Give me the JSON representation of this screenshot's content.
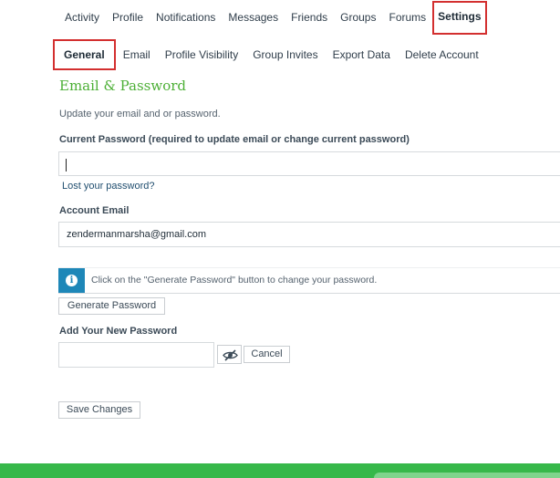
{
  "topnav": {
    "items": [
      {
        "label": "Activity"
      },
      {
        "label": "Profile"
      },
      {
        "label": "Notifications"
      },
      {
        "label": "Messages"
      },
      {
        "label": "Friends"
      },
      {
        "label": "Groups"
      },
      {
        "label": "Forums"
      },
      {
        "label": "Settings",
        "active": true
      }
    ]
  },
  "subnav": {
    "items": [
      {
        "label": "General",
        "active": true
      },
      {
        "label": "Email"
      },
      {
        "label": "Profile Visibility"
      },
      {
        "label": "Group Invites"
      },
      {
        "label": "Export Data"
      },
      {
        "label": "Delete Account"
      }
    ]
  },
  "section": {
    "title": "Email & Password",
    "description": "Update your email and or password."
  },
  "current_password": {
    "label": "Current Password (required to update email or change current password)",
    "value": "",
    "lost_link": "Lost your password?"
  },
  "account_email": {
    "label": "Account Email",
    "value": "zendermanmarsha@gmail.com"
  },
  "notice": {
    "icon": "info-icon",
    "text": "Click on the \"Generate Password\" button to change your password."
  },
  "generate_button": "Generate Password",
  "new_password": {
    "label": "Add Your New Password",
    "value": "",
    "toggle_icon": "eye-slash-icon",
    "cancel_label": "Cancel"
  },
  "save_button": "Save Changes",
  "colors": {
    "accent_green": "#4caf35",
    "footer_green": "#37b84a",
    "info_blue": "#1e87b8",
    "highlight_red": "#d32f2f"
  }
}
